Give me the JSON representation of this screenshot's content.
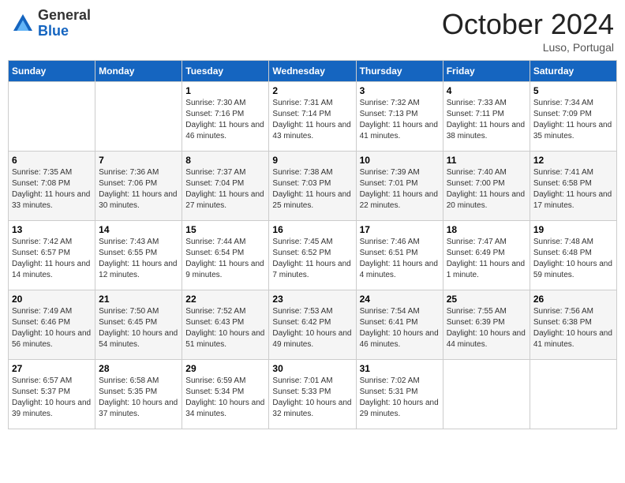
{
  "header": {
    "logo_general": "General",
    "logo_blue": "Blue",
    "month": "October 2024",
    "location": "Luso, Portugal"
  },
  "weekdays": [
    "Sunday",
    "Monday",
    "Tuesday",
    "Wednesday",
    "Thursday",
    "Friday",
    "Saturday"
  ],
  "weeks": [
    [
      {
        "day": "",
        "sunrise": "",
        "sunset": "",
        "daylight": ""
      },
      {
        "day": "",
        "sunrise": "",
        "sunset": "",
        "daylight": ""
      },
      {
        "day": "1",
        "sunrise": "Sunrise: 7:30 AM",
        "sunset": "Sunset: 7:16 PM",
        "daylight": "Daylight: 11 hours and 46 minutes."
      },
      {
        "day": "2",
        "sunrise": "Sunrise: 7:31 AM",
        "sunset": "Sunset: 7:14 PM",
        "daylight": "Daylight: 11 hours and 43 minutes."
      },
      {
        "day": "3",
        "sunrise": "Sunrise: 7:32 AM",
        "sunset": "Sunset: 7:13 PM",
        "daylight": "Daylight: 11 hours and 41 minutes."
      },
      {
        "day": "4",
        "sunrise": "Sunrise: 7:33 AM",
        "sunset": "Sunset: 7:11 PM",
        "daylight": "Daylight: 11 hours and 38 minutes."
      },
      {
        "day": "5",
        "sunrise": "Sunrise: 7:34 AM",
        "sunset": "Sunset: 7:09 PM",
        "daylight": "Daylight: 11 hours and 35 minutes."
      }
    ],
    [
      {
        "day": "6",
        "sunrise": "Sunrise: 7:35 AM",
        "sunset": "Sunset: 7:08 PM",
        "daylight": "Daylight: 11 hours and 33 minutes."
      },
      {
        "day": "7",
        "sunrise": "Sunrise: 7:36 AM",
        "sunset": "Sunset: 7:06 PM",
        "daylight": "Daylight: 11 hours and 30 minutes."
      },
      {
        "day": "8",
        "sunrise": "Sunrise: 7:37 AM",
        "sunset": "Sunset: 7:04 PM",
        "daylight": "Daylight: 11 hours and 27 minutes."
      },
      {
        "day": "9",
        "sunrise": "Sunrise: 7:38 AM",
        "sunset": "Sunset: 7:03 PM",
        "daylight": "Daylight: 11 hours and 25 minutes."
      },
      {
        "day": "10",
        "sunrise": "Sunrise: 7:39 AM",
        "sunset": "Sunset: 7:01 PM",
        "daylight": "Daylight: 11 hours and 22 minutes."
      },
      {
        "day": "11",
        "sunrise": "Sunrise: 7:40 AM",
        "sunset": "Sunset: 7:00 PM",
        "daylight": "Daylight: 11 hours and 20 minutes."
      },
      {
        "day": "12",
        "sunrise": "Sunrise: 7:41 AM",
        "sunset": "Sunset: 6:58 PM",
        "daylight": "Daylight: 11 hours and 17 minutes."
      }
    ],
    [
      {
        "day": "13",
        "sunrise": "Sunrise: 7:42 AM",
        "sunset": "Sunset: 6:57 PM",
        "daylight": "Daylight: 11 hours and 14 minutes."
      },
      {
        "day": "14",
        "sunrise": "Sunrise: 7:43 AM",
        "sunset": "Sunset: 6:55 PM",
        "daylight": "Daylight: 11 hours and 12 minutes."
      },
      {
        "day": "15",
        "sunrise": "Sunrise: 7:44 AM",
        "sunset": "Sunset: 6:54 PM",
        "daylight": "Daylight: 11 hours and 9 minutes."
      },
      {
        "day": "16",
        "sunrise": "Sunrise: 7:45 AM",
        "sunset": "Sunset: 6:52 PM",
        "daylight": "Daylight: 11 hours and 7 minutes."
      },
      {
        "day": "17",
        "sunrise": "Sunrise: 7:46 AM",
        "sunset": "Sunset: 6:51 PM",
        "daylight": "Daylight: 11 hours and 4 minutes."
      },
      {
        "day": "18",
        "sunrise": "Sunrise: 7:47 AM",
        "sunset": "Sunset: 6:49 PM",
        "daylight": "Daylight: 11 hours and 1 minute."
      },
      {
        "day": "19",
        "sunrise": "Sunrise: 7:48 AM",
        "sunset": "Sunset: 6:48 PM",
        "daylight": "Daylight: 10 hours and 59 minutes."
      }
    ],
    [
      {
        "day": "20",
        "sunrise": "Sunrise: 7:49 AM",
        "sunset": "Sunset: 6:46 PM",
        "daylight": "Daylight: 10 hours and 56 minutes."
      },
      {
        "day": "21",
        "sunrise": "Sunrise: 7:50 AM",
        "sunset": "Sunset: 6:45 PM",
        "daylight": "Daylight: 10 hours and 54 minutes."
      },
      {
        "day": "22",
        "sunrise": "Sunrise: 7:52 AM",
        "sunset": "Sunset: 6:43 PM",
        "daylight": "Daylight: 10 hours and 51 minutes."
      },
      {
        "day": "23",
        "sunrise": "Sunrise: 7:53 AM",
        "sunset": "Sunset: 6:42 PM",
        "daylight": "Daylight: 10 hours and 49 minutes."
      },
      {
        "day": "24",
        "sunrise": "Sunrise: 7:54 AM",
        "sunset": "Sunset: 6:41 PM",
        "daylight": "Daylight: 10 hours and 46 minutes."
      },
      {
        "day": "25",
        "sunrise": "Sunrise: 7:55 AM",
        "sunset": "Sunset: 6:39 PM",
        "daylight": "Daylight: 10 hours and 44 minutes."
      },
      {
        "day": "26",
        "sunrise": "Sunrise: 7:56 AM",
        "sunset": "Sunset: 6:38 PM",
        "daylight": "Daylight: 10 hours and 41 minutes."
      }
    ],
    [
      {
        "day": "27",
        "sunrise": "Sunrise: 6:57 AM",
        "sunset": "Sunset: 5:37 PM",
        "daylight": "Daylight: 10 hours and 39 minutes."
      },
      {
        "day": "28",
        "sunrise": "Sunrise: 6:58 AM",
        "sunset": "Sunset: 5:35 PM",
        "daylight": "Daylight: 10 hours and 37 minutes."
      },
      {
        "day": "29",
        "sunrise": "Sunrise: 6:59 AM",
        "sunset": "Sunset: 5:34 PM",
        "daylight": "Daylight: 10 hours and 34 minutes."
      },
      {
        "day": "30",
        "sunrise": "Sunrise: 7:01 AM",
        "sunset": "Sunset: 5:33 PM",
        "daylight": "Daylight: 10 hours and 32 minutes."
      },
      {
        "day": "31",
        "sunrise": "Sunrise: 7:02 AM",
        "sunset": "Sunset: 5:31 PM",
        "daylight": "Daylight: 10 hours and 29 minutes."
      },
      {
        "day": "",
        "sunrise": "",
        "sunset": "",
        "daylight": ""
      },
      {
        "day": "",
        "sunrise": "",
        "sunset": "",
        "daylight": ""
      }
    ]
  ]
}
